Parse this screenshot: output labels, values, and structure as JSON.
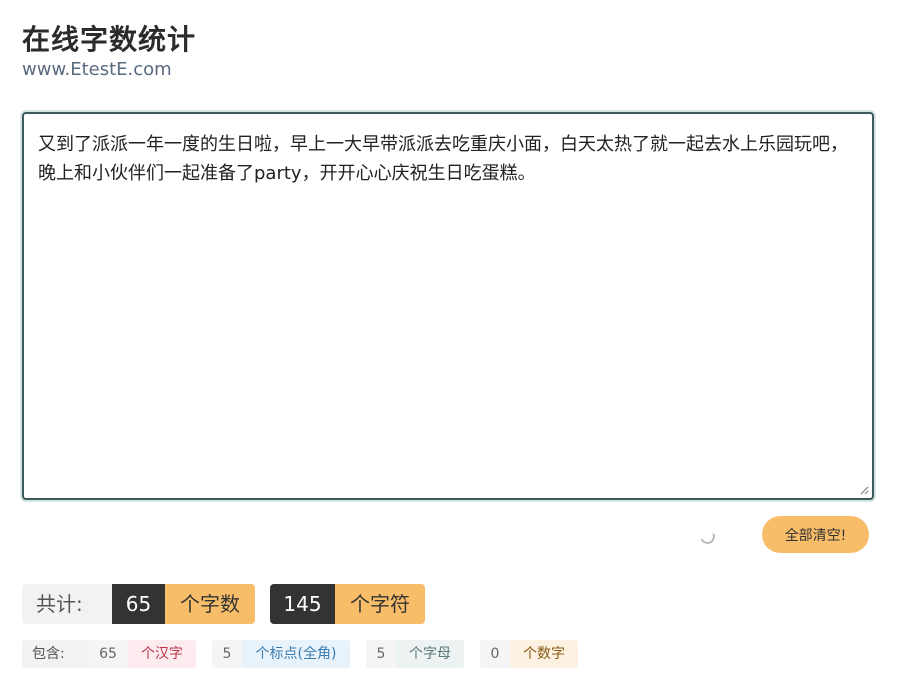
{
  "header": {
    "title": "在线字数统计",
    "subtitle": "www.EtestE.com"
  },
  "editor": {
    "text": "又到了派派一年一度的生日啦，早上一大早带派派去吃重庆小面，白天太热了就一起去水上乐园玩吧，晚上和小伙伴们一起准备了party，开开心心庆祝生日吃蛋糕。"
  },
  "actions": {
    "clear_label": "全部清空!"
  },
  "totals": {
    "label": "共计:",
    "word_count": "65",
    "word_unit": "个字数",
    "char_count": "145",
    "char_unit": "个字符"
  },
  "breakdown": {
    "label": "包含:",
    "items": [
      {
        "count": "65",
        "unit": "个汉字",
        "color": "#c0344e",
        "bg": "#fdecef"
      },
      {
        "count": "5",
        "unit": "个标点(全角)",
        "color": "#3b7db0",
        "bg": "#e8f2fa"
      },
      {
        "count": "5",
        "unit": "个字母",
        "color": "#5a7a7a",
        "bg": "#edf2f2"
      },
      {
        "count": "0",
        "unit": "个数字",
        "color": "#8a5a14",
        "bg": "#fdf1e1"
      }
    ]
  }
}
